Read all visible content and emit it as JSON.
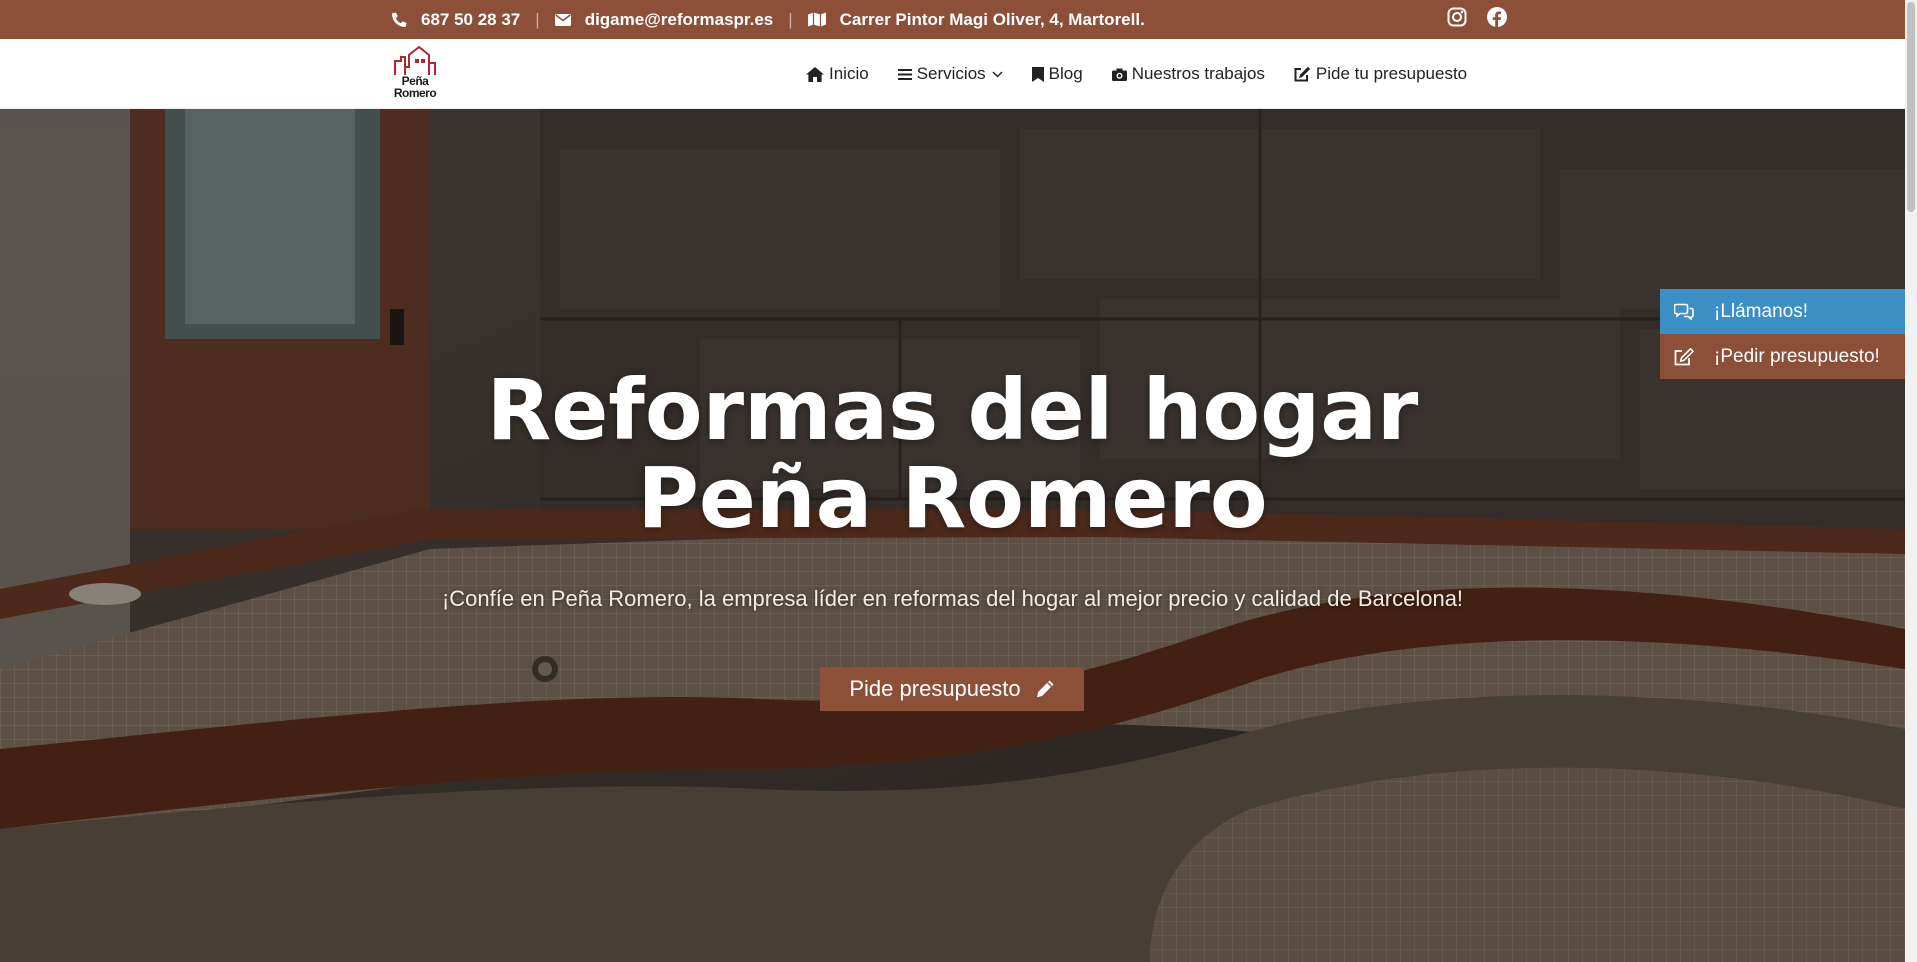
{
  "topbar": {
    "phone": "687 50 28 37",
    "email": "digame@reformaspr.es",
    "address": "Carrer Pintor Magi Oliver, 4, Martorell.",
    "separator": "|",
    "social_icons": [
      "instagram-icon",
      "facebook-icon"
    ]
  },
  "logo": {
    "line1": "Peña",
    "line2": "Romero"
  },
  "nav": {
    "items": [
      {
        "label": "Inicio",
        "icon": "home-icon"
      },
      {
        "label": "Servicios",
        "icon": "menu-icon",
        "has_dropdown": true
      },
      {
        "label": "Blog",
        "icon": "bookmark-icon"
      },
      {
        "label": "Nuestros trabajos",
        "icon": "camera-icon"
      },
      {
        "label": "Pide tu presupuesto",
        "icon": "edit-icon"
      }
    ]
  },
  "hero": {
    "title_line1": "Reformas del hogar",
    "title_line2": "Peña Romero",
    "subtitle": "¡Confíe en Peña Romero, la empresa líder en reformas del hogar al mejor precio y calidad de Barcelona!",
    "cta_label": "Pide presupuesto"
  },
  "side_buttons": {
    "call_label": "¡Llámanos!",
    "quote_label": "¡Pedir presupuesto!"
  },
  "colors": {
    "brand_brown": "#8b5037",
    "call_blue": "#3b8fc4",
    "white": "#ffffff",
    "text_dark": "#222222"
  }
}
